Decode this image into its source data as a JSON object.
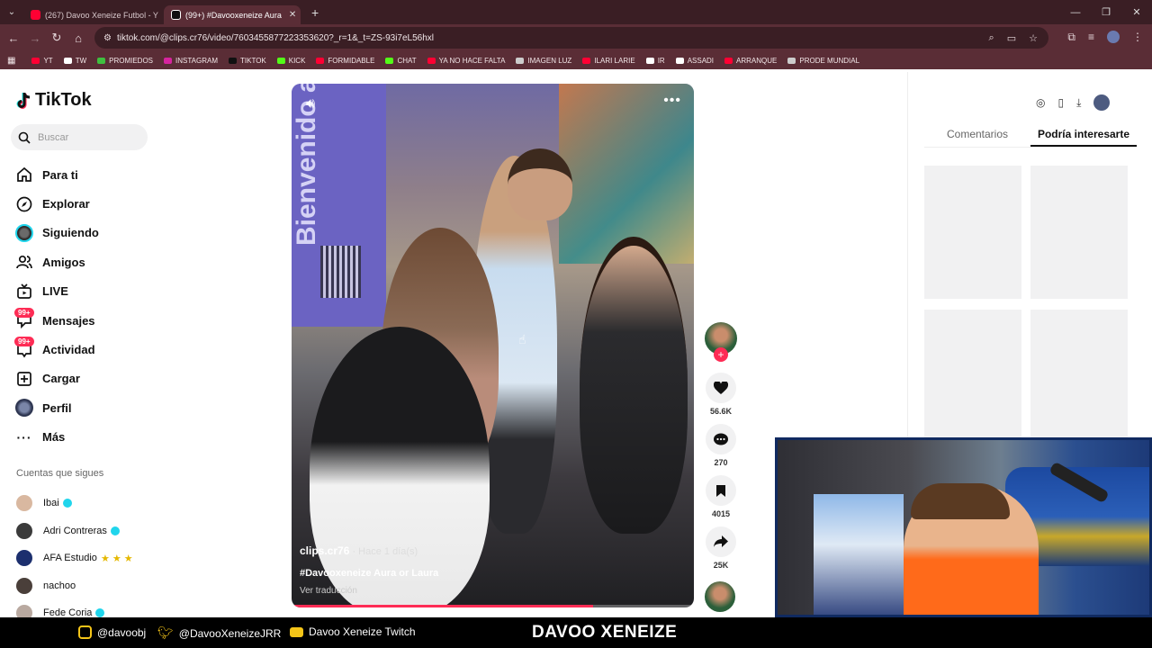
{
  "browser": {
    "tabs": [
      {
        "title": "(267) Davoo Xeneize Futbol - Y",
        "icon_color": "#ff0033",
        "active": false
      },
      {
        "title": "(99+) #Davooxeneize Aura",
        "icon_color": "#111111",
        "active": true
      }
    ],
    "new_tab": "+",
    "url": "tiktok.com/@clips.cr76/video/7603455877223353620?_r=1&_t=ZS-93i7eL56hxl",
    "bookmarks": [
      {
        "label": "YT",
        "color": "#ff0033"
      },
      {
        "label": "TW",
        "color": "#ffffff"
      },
      {
        "label": "PROMIEDOS",
        "color": "#3fbf3f"
      },
      {
        "label": "INSTAGRAM",
        "color": "#d6249f"
      },
      {
        "label": "TIKTOK",
        "color": "#111111"
      },
      {
        "label": "KICK",
        "color": "#53fc18"
      },
      {
        "label": "FORMIDABLE",
        "color": "#ff0033"
      },
      {
        "label": "CHAT",
        "color": "#53fc18"
      },
      {
        "label": "YA NO HACE FALTA",
        "color": "#ff0033"
      },
      {
        "label": "IMAGEN LUZ",
        "color": "#cccccc"
      },
      {
        "label": "ILARI LARIE",
        "color": "#ff0033"
      },
      {
        "label": "IR",
        "color": "#ffffff"
      },
      {
        "label": "ASSADI",
        "color": "#ffffff"
      },
      {
        "label": "ARRANQUE",
        "color": "#ff0033"
      },
      {
        "label": "PRODE MUNDIAL",
        "color": "#cccccc"
      }
    ]
  },
  "tiktok": {
    "logo": "TikTok",
    "search_placeholder": "Buscar",
    "nav": [
      {
        "label": "Para ti",
        "icon": "home-icon",
        "badge": ""
      },
      {
        "label": "Explorar",
        "icon": "compass-icon",
        "badge": ""
      },
      {
        "label": "Siguiendo",
        "icon": "following-avatar-icon",
        "badge": ""
      },
      {
        "label": "Amigos",
        "icon": "friends-icon",
        "badge": ""
      },
      {
        "label": "LIVE",
        "icon": "live-icon",
        "badge": ""
      },
      {
        "label": "Mensajes",
        "icon": "messages-icon",
        "badge": "99+"
      },
      {
        "label": "Actividad",
        "icon": "activity-icon",
        "badge": "99+"
      },
      {
        "label": "Cargar",
        "icon": "upload-icon",
        "badge": ""
      },
      {
        "label": "Perfil",
        "icon": "profile-avatar-icon",
        "badge": ""
      },
      {
        "label": "Más",
        "icon": "more-icon",
        "badge": ""
      }
    ],
    "following_title": "Cuentas que sigues",
    "following": [
      {
        "name": "Ibai",
        "verified": true,
        "stars": ""
      },
      {
        "name": "Adri Contreras",
        "verified": true,
        "stars": ""
      },
      {
        "name": "AFA Estudio",
        "verified": false,
        "stars": "★ ★ ★"
      },
      {
        "name": "nachoo",
        "verified": false,
        "stars": ""
      },
      {
        "name": "Fede Coria",
        "verified": true,
        "stars": ""
      }
    ],
    "video": {
      "banner_text": "Bienvenido al Club",
      "author": "clips.cr76",
      "time": "· Hace 1 día(s)",
      "caption": "#Davooxeneize Aura or Laura",
      "translate": "Ver traducción",
      "progress": 0.75
    },
    "actions": {
      "likes": "56.6K",
      "comments": "270",
      "saves": "4015",
      "shares": "25K"
    },
    "right_panel": {
      "tabs": [
        "Comentarios",
        "Podría interesarte"
      ],
      "active_tab": 1
    }
  },
  "footer": {
    "instagram": "@davoobj",
    "twitter": "@DavooXeneizeJRR",
    "youtube": "Davoo Xeneize Twitch",
    "brand": "DAVOO XENEIZE"
  }
}
